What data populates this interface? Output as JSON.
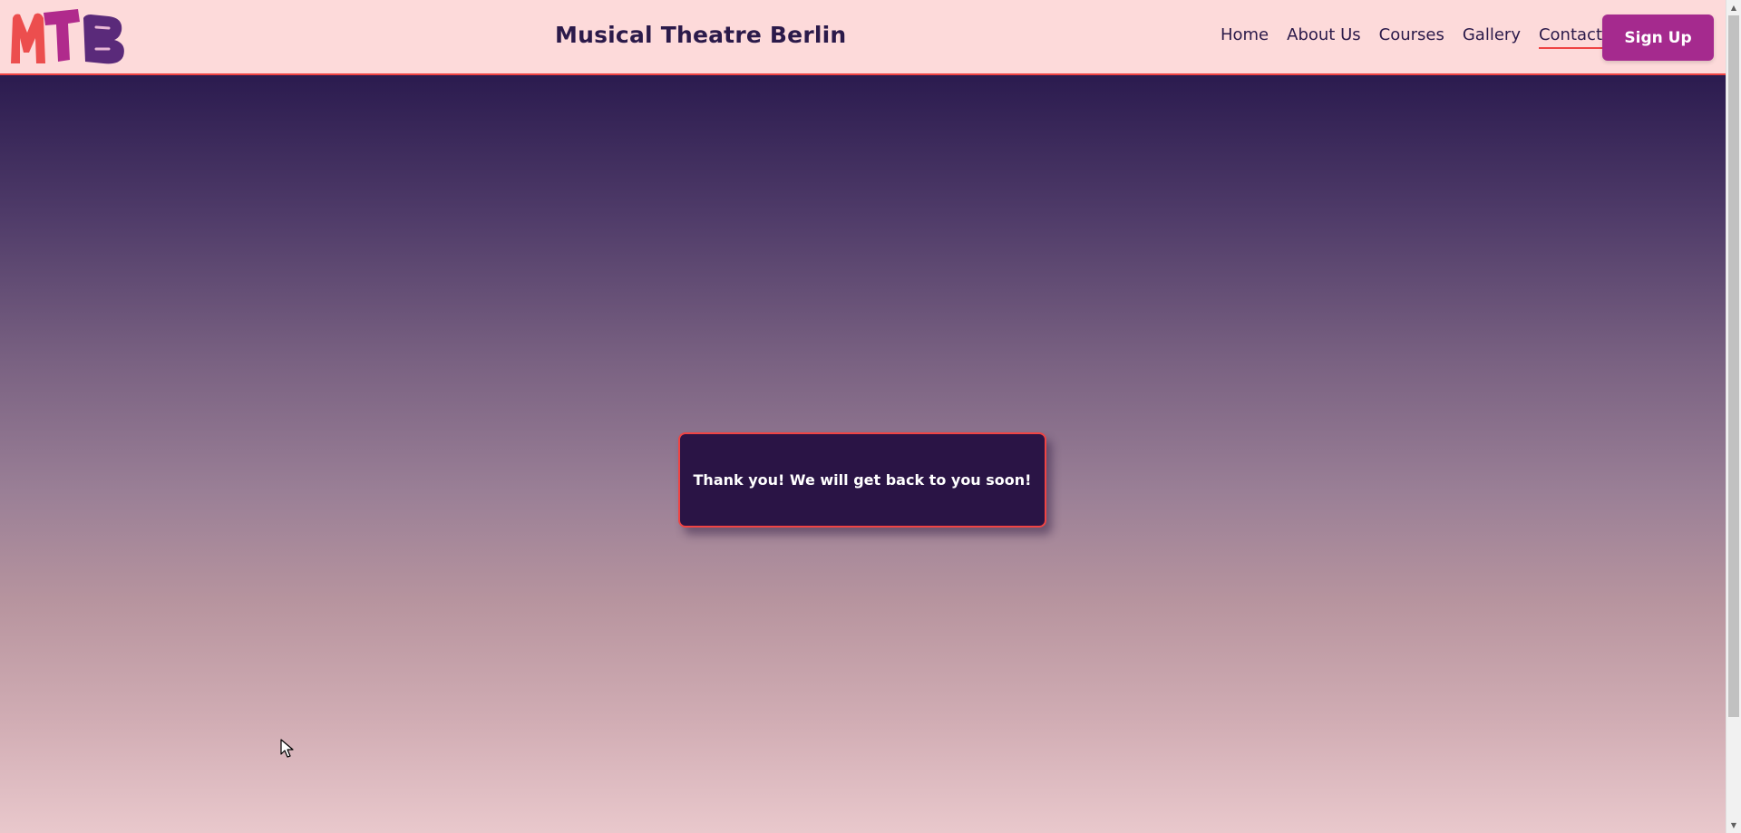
{
  "header": {
    "logo_text": "MTB",
    "site_title": "Musical Theatre Berlin",
    "nav": [
      {
        "label": "Home",
        "active": false
      },
      {
        "label": "About Us",
        "active": false
      },
      {
        "label": "Courses",
        "active": false
      },
      {
        "label": "Gallery",
        "active": false
      },
      {
        "label": "Contact",
        "active": true
      }
    ],
    "signup_label": "Sign Up"
  },
  "toast": {
    "message": "Thank you! We will get back to you soon!"
  },
  "colors": {
    "header_bg": "#fddada",
    "accent_red": "#ef4444",
    "brand_purple": "#2b1a4a",
    "button_magenta": "#a52a8e",
    "toast_bg": "#2a1445"
  },
  "icons": {
    "cursor": "mouse-pointer-icon",
    "scroll_up": "scroll-up-arrow-icon",
    "scroll_down": "scroll-down-arrow-icon"
  }
}
